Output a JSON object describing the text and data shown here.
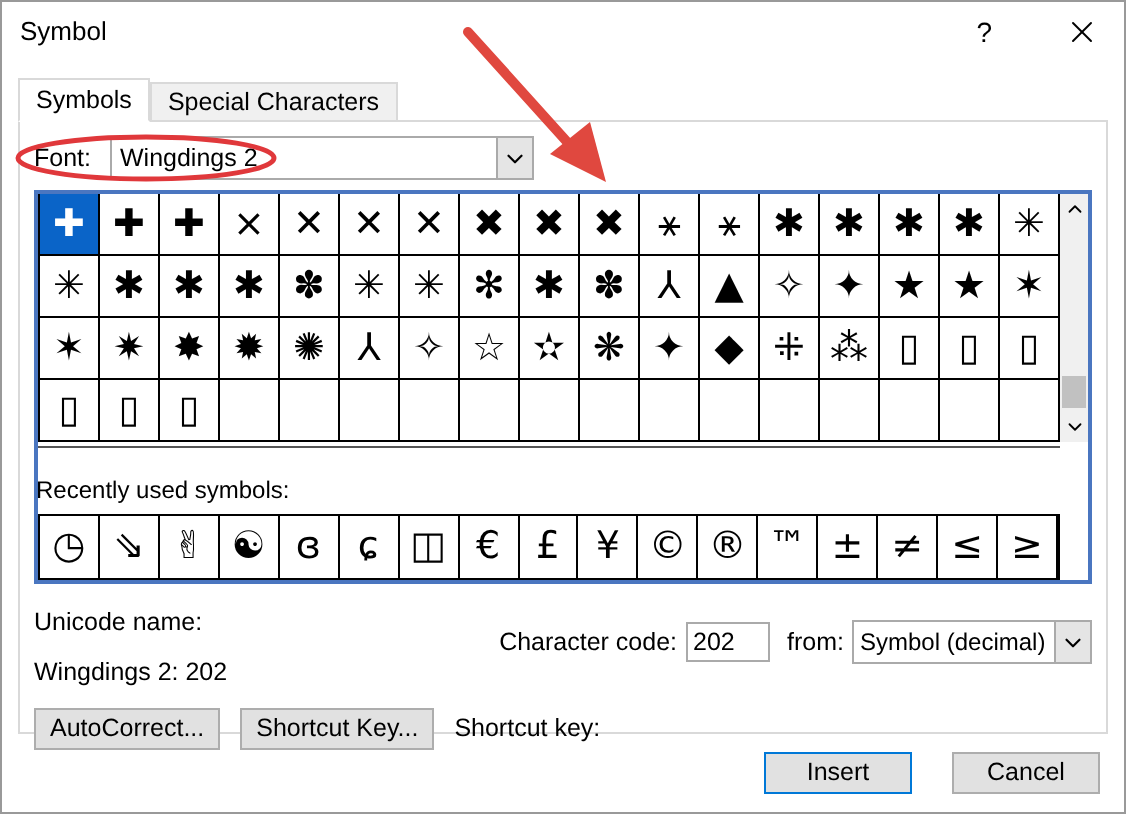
{
  "window": {
    "title": "Symbol",
    "help": "?"
  },
  "tabs": [
    {
      "label": "Symbols",
      "selected": true
    },
    {
      "label": "Special Characters",
      "selected": false
    }
  ],
  "font": {
    "label": "Font:",
    "value": "Wingdings 2"
  },
  "grid": [
    [
      {
        "char": "✚",
        "selected": true
      },
      {
        "char": "✚",
        "selected": false
      },
      {
        "char": "✚",
        "selected": false
      },
      {
        "char": "×",
        "selected": false
      },
      {
        "char": "✕",
        "selected": false
      },
      {
        "char": "✕",
        "selected": false
      },
      {
        "char": "✕",
        "selected": false
      },
      {
        "char": "✖",
        "selected": false
      },
      {
        "char": "✖",
        "selected": false
      },
      {
        "char": "✖",
        "selected": false
      },
      {
        "char": "⚹",
        "selected": false
      },
      {
        "char": "⚹",
        "selected": false
      },
      {
        "char": "✱",
        "selected": false
      },
      {
        "char": "✱",
        "selected": false
      },
      {
        "char": "✱",
        "selected": false
      },
      {
        "char": "✱",
        "selected": false
      },
      {
        "char": "✳",
        "selected": false
      }
    ],
    [
      {
        "char": "✳",
        "selected": false
      },
      {
        "char": "✱",
        "selected": false
      },
      {
        "char": "✱",
        "selected": false
      },
      {
        "char": "✱",
        "selected": false
      },
      {
        "char": "✽",
        "selected": false
      },
      {
        "char": "✳",
        "selected": false
      },
      {
        "char": "✳",
        "selected": false
      },
      {
        "char": "✻",
        "selected": false
      },
      {
        "char": "✱",
        "selected": false
      },
      {
        "char": "✽",
        "selected": false
      },
      {
        "char": "⅄",
        "selected": false
      },
      {
        "char": "▲",
        "selected": false
      },
      {
        "char": "✧",
        "selected": false
      },
      {
        "char": "✦",
        "selected": false
      },
      {
        "char": "★",
        "selected": false
      },
      {
        "char": "★",
        "selected": false
      },
      {
        "char": "✶",
        "selected": false
      }
    ],
    [
      {
        "char": "✶",
        "selected": false
      },
      {
        "char": "✷",
        "selected": false
      },
      {
        "char": "✸",
        "selected": false
      },
      {
        "char": "✹",
        "selected": false
      },
      {
        "char": "✺",
        "selected": false
      },
      {
        "char": "⅄",
        "selected": false
      },
      {
        "char": "✧",
        "selected": false
      },
      {
        "char": "☆",
        "selected": false
      },
      {
        "char": "✫",
        "selected": false
      },
      {
        "char": "❋",
        "selected": false
      },
      {
        "char": "✦",
        "selected": false
      },
      {
        "char": "◆",
        "selected": false
      },
      {
        "char": "⁜",
        "selected": false
      },
      {
        "char": "⁂",
        "selected": false
      },
      {
        "char": "▯",
        "selected": false
      },
      {
        "char": "▯",
        "selected": false
      },
      {
        "char": "▯",
        "selected": false
      }
    ],
    [
      {
        "char": "▯",
        "selected": false
      },
      {
        "char": "▯",
        "selected": false
      },
      {
        "char": "▯",
        "selected": false
      }
    ]
  ],
  "recent": {
    "label": "Recently used symbols:",
    "symbols": [
      "◷",
      "⇘",
      "✌",
      "☯",
      "ɞ",
      "ɕ",
      "◫",
      "€",
      "£",
      "¥",
      "©",
      "®",
      "™",
      "±",
      "≠",
      "≤",
      "≥"
    ]
  },
  "unicode_name": {
    "label": "Unicode name:",
    "value": "Wingdings 2: 202"
  },
  "character_code": {
    "label": "Character code:",
    "value": "202"
  },
  "from": {
    "label": "from:",
    "value": "Symbol (decimal)"
  },
  "buttons": [
    "AutoCorrect...",
    "Shortcut Key..."
  ],
  "shortcut_key": {
    "label": "Shortcut key:"
  },
  "footer_buttons": [
    "Insert",
    "Cancel"
  ]
}
